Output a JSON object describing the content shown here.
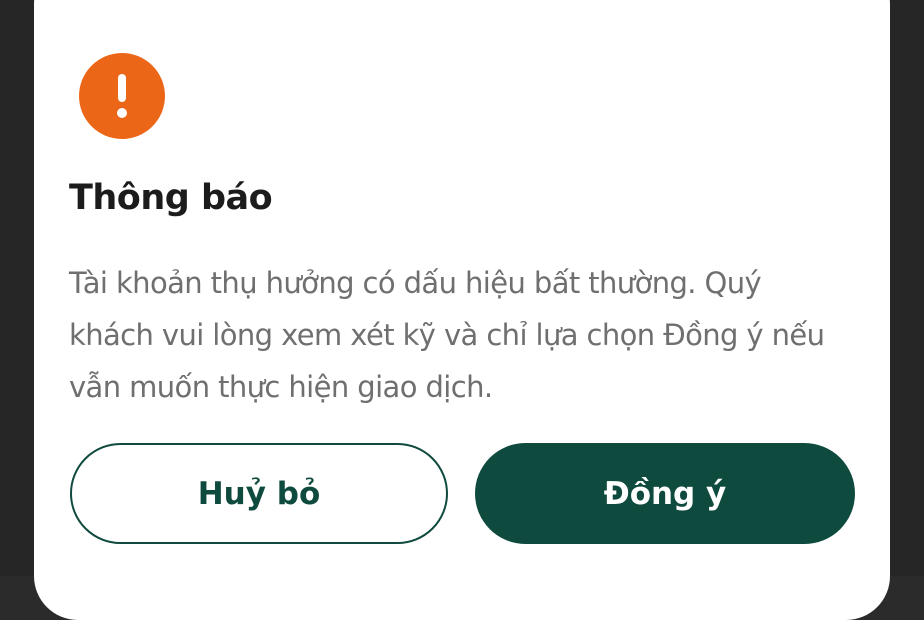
{
  "dialog": {
    "icon": "exclamation-icon",
    "icon_color": "#ec6618",
    "title": "Thông báo",
    "message": "Tài khoản thụ hưởng có dấu hiệu bất thường. Quý khách vui lòng xem xét kỹ và chỉ lựa chọn Đồng ý nếu vẫn muốn thực hiện giao dịch.",
    "cancel_label": "Huỷ bỏ",
    "confirm_label": "Đồng ý",
    "accent_color": "#0f4a3e"
  }
}
